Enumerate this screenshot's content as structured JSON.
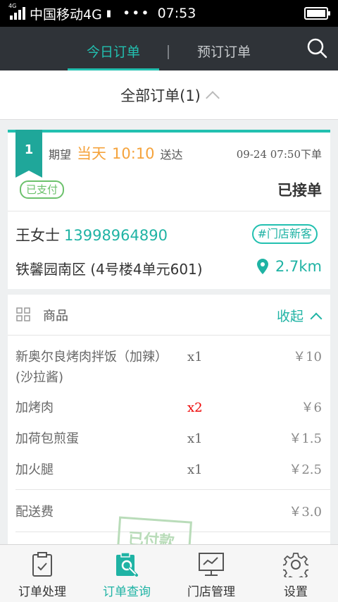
{
  "status_bar": {
    "network_tag": "4G",
    "carrier": "中国移动4G",
    "sim_glyph": "▮",
    "dots": "•••",
    "time": "07:53"
  },
  "header": {
    "tabs": [
      {
        "label": "今日订单",
        "active": true
      },
      {
        "label": "预订订单",
        "active": false
      }
    ]
  },
  "filter": {
    "label": "全部订单(1)"
  },
  "order": {
    "number": "1",
    "expect_prefix": "期望",
    "expect_day": "当天",
    "expect_time": "10:10",
    "expect_suffix": "送达",
    "order_time": "09-24 07:50下单",
    "paid_badge": "已支付",
    "status": "已接单",
    "customer_name": "王女士",
    "customer_phone": "13998964890",
    "new_customer_tag": "#门店新客",
    "address": "铁馨园南区 (4号楼4单元601)",
    "distance": "2.7km"
  },
  "goods": {
    "title": "商品",
    "collapse_label": "收起",
    "items": [
      {
        "name": "新奥尔良烤肉拌饭（加辣）(沙拉酱)",
        "qty": "x1",
        "price": "￥10"
      },
      {
        "name": "加烤肉",
        "qty": "x2",
        "price": "￥6"
      },
      {
        "name": "加荷包煎蛋",
        "qty": "x1",
        "price": "￥1.5"
      },
      {
        "name": "加火腿",
        "qty": "x1",
        "price": "￥2.5"
      }
    ],
    "delivery_fee_label": "配送费",
    "delivery_fee": "￥3.0",
    "stamp_text": "已付款"
  },
  "bottom_nav": [
    {
      "label": "订单处理",
      "icon": "clipboard-check-icon",
      "active": false
    },
    {
      "label": "订单查询",
      "icon": "clipboard-search-icon",
      "active": true
    },
    {
      "label": "门店管理",
      "icon": "monitor-chart-icon",
      "active": false
    },
    {
      "label": "设置",
      "icon": "gear-icon",
      "active": false
    }
  ],
  "colors": {
    "accent": "#22c0b0",
    "header_bg": "#2f3338",
    "expect_time": "#f5a33c",
    "paid_green": "#6cc16c",
    "qty_highlight": "#e00000"
  }
}
